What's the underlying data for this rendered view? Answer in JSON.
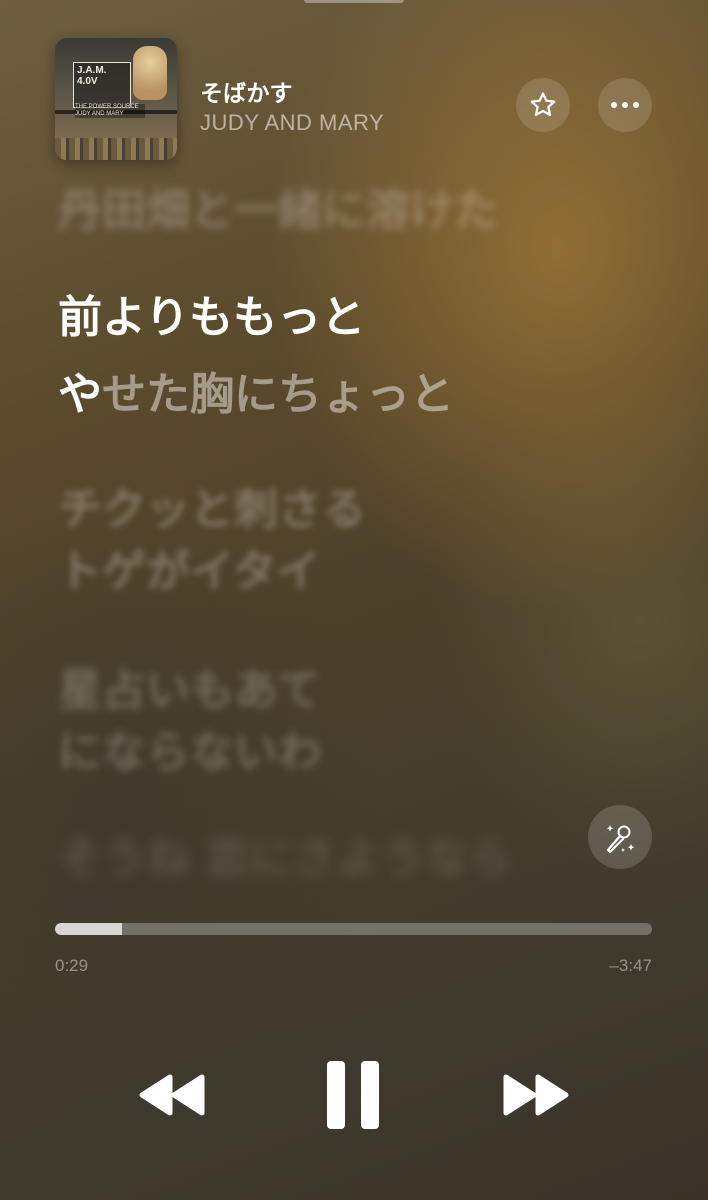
{
  "now_playing": {
    "title": "そばかす",
    "artist": "JUDY AND MARY",
    "artwork": {
      "label_text": "J.A.M.\n4.0V",
      "strip_text": "THE POWER SOURCE JUDY AND MARY"
    }
  },
  "header": {
    "favorite_icon": "star-outline-icon",
    "more_icon": "ellipsis-icon"
  },
  "lyrics": {
    "previous_line": "丹田畑と一緒に溶けた",
    "current_line_1": "前よりももっと",
    "current_line_2_sung": "や",
    "current_line_2_unsung": "せた胸にちょっと",
    "next_lines": [
      "チクッと刺さる",
      "トゲがイタイ",
      "星占いもあて",
      "にならないわ",
      "そうね 恋にさようなら"
    ]
  },
  "controls": {
    "sing_icon": "microphone-sparkle-icon",
    "progress_fraction": 0.113,
    "elapsed": "0:29",
    "remaining": "–3:47",
    "prev_icon": "rewind-icon",
    "pause_icon": "pause-icon",
    "next_icon": "fast-forward-icon"
  }
}
